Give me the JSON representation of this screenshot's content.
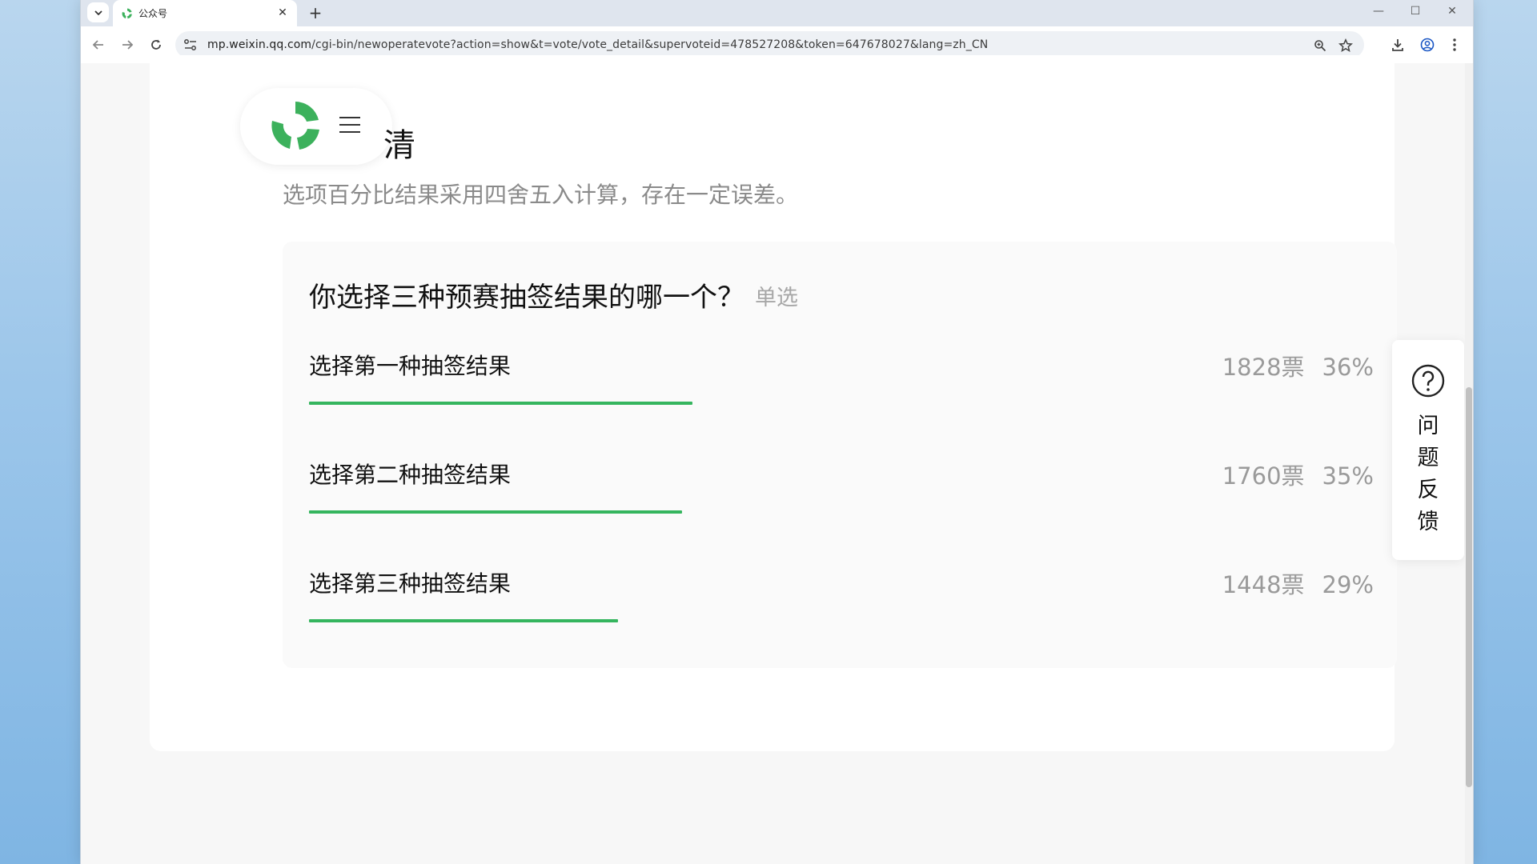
{
  "browser": {
    "tab_title": "公众号",
    "url_host": "mp.weixin.qq.com",
    "url_path": "/cgi-bin/newoperatevote?action=show&t=vote/vote_detail&supervoteid=478527208&token=647678027&lang=zh_CN"
  },
  "header": {
    "title_fragment": "清"
  },
  "notice": "选项百分比结果采用四舍五入计算，存在一定误差。",
  "vote": {
    "question": "你选择三种预赛抽签结果的哪一个？",
    "type_label": "单选",
    "options": [
      {
        "label": "选择第一种抽签结果",
        "votes": "1828票",
        "percent": "36%",
        "fill_fraction": 0.36
      },
      {
        "label": "选择第二种抽签结果",
        "votes": "1760票",
        "percent": "35%",
        "fill_fraction": 0.35
      },
      {
        "label": "选择第三种抽签结果",
        "votes": "1448票",
        "percent": "29%",
        "fill_fraction": 0.29
      }
    ]
  },
  "feedback": {
    "label": "问题反馈"
  },
  "colors": {
    "accent_green": "#35b55e",
    "text_muted": "#9a9a9a"
  }
}
